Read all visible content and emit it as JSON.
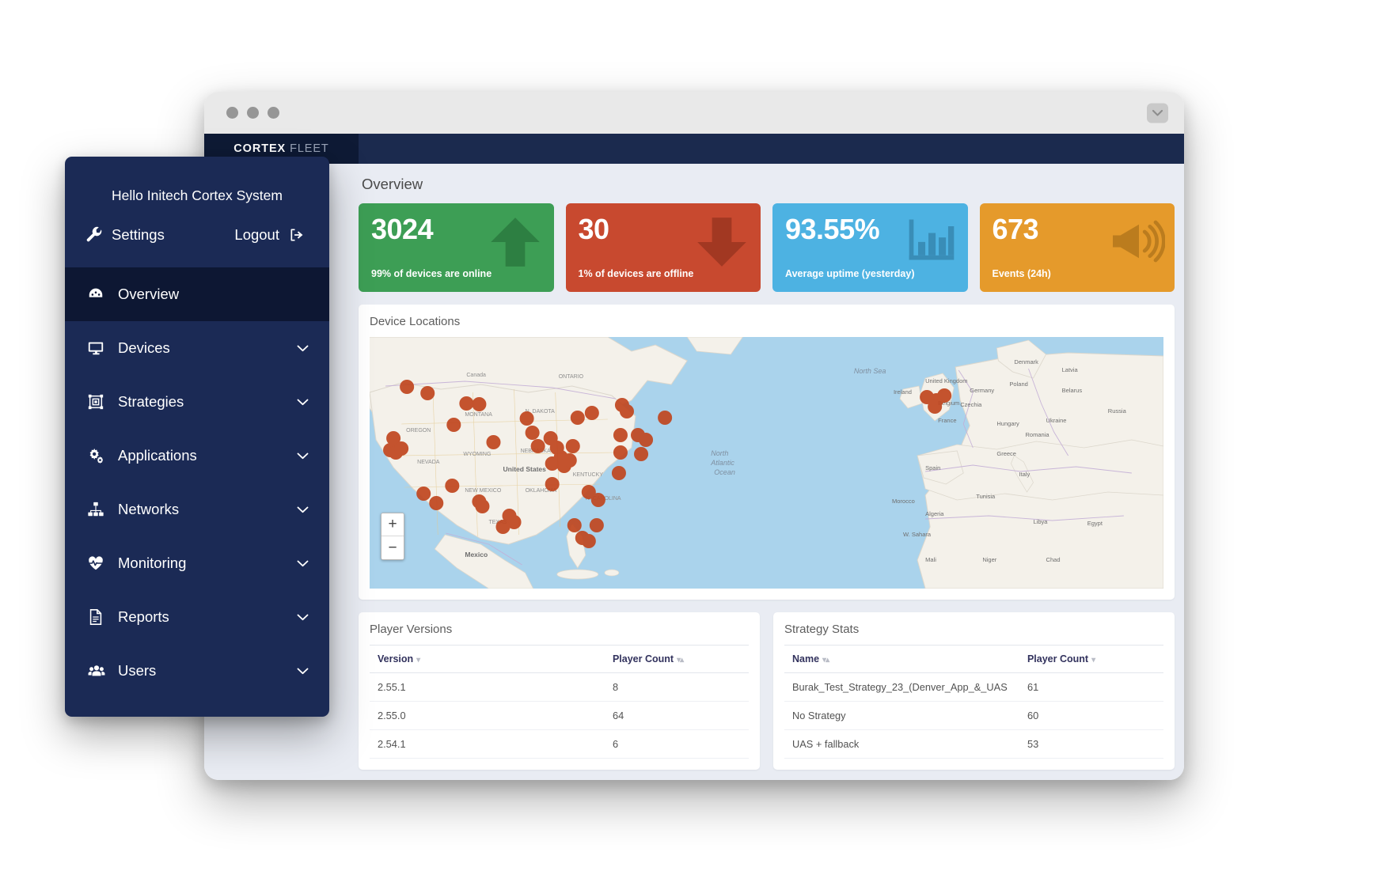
{
  "window": {
    "brand_primary": "CORTEX",
    "brand_secondary": "FLEET",
    "chevron_icon": "chevron-down-icon"
  },
  "sidebar": {
    "greeting": "Hello Initech Cortex System",
    "settings_label": "Settings",
    "logout_label": "Logout",
    "items": [
      {
        "label": "Overview",
        "icon": "gauge-icon",
        "active": true,
        "caret": false
      },
      {
        "label": "Devices",
        "icon": "monitor-icon",
        "active": false,
        "caret": true
      },
      {
        "label": "Strategies",
        "icon": "crop-icon",
        "active": false,
        "caret": true
      },
      {
        "label": "Applications",
        "icon": "gears-icon",
        "active": false,
        "caret": true
      },
      {
        "label": "Networks",
        "icon": "sitemap-icon",
        "active": false,
        "caret": true
      },
      {
        "label": "Monitoring",
        "icon": "heartbeat-icon",
        "active": false,
        "caret": true
      },
      {
        "label": "Reports",
        "icon": "document-icon",
        "active": false,
        "caret": true
      },
      {
        "label": "Users",
        "icon": "users-icon",
        "active": false,
        "caret": true
      }
    ]
  },
  "main": {
    "page_title": "Overview",
    "stats": [
      {
        "value": "3024",
        "caption": "99% of devices are online",
        "color": "#3d9e55",
        "icon": "arrow-up-icon"
      },
      {
        "value": "30",
        "caption": "1% of devices are offline",
        "color": "#c8492f",
        "icon": "arrow-down-icon"
      },
      {
        "value": "93.55%",
        "caption": "Average uptime (yesterday)",
        "color": "#4db2e2",
        "icon": "bar-chart-icon"
      },
      {
        "value": "673",
        "caption": "Events (24h)",
        "color": "#e59a2b",
        "icon": "megaphone-icon"
      }
    ],
    "map": {
      "title": "Device Locations",
      "zoom_in_label": "+",
      "zoom_out_label": "−",
      "marker_color": "#c0461f",
      "water_color": "#aad3ec",
      "land_color": "#f3f0ea"
    },
    "player_versions": {
      "title": "Player Versions",
      "columns": [
        "Version",
        "Player Count"
      ],
      "sort_glyphs": [
        "▾",
        "▾▴"
      ],
      "rows": [
        [
          "2.55.1",
          "8"
        ],
        [
          "2.55.0",
          "64"
        ],
        [
          "2.54.1",
          "6"
        ]
      ]
    },
    "strategy_stats": {
      "title": "Strategy Stats",
      "columns": [
        "Name",
        "Player Count"
      ],
      "sort_glyphs": [
        "▾▴",
        "▾"
      ],
      "rows": [
        [
          "Burak_Test_Strategy_23_(Denver_App_&_UAS",
          "61"
        ],
        [
          "No Strategy",
          "60"
        ],
        [
          "UAS + fallback",
          "53"
        ]
      ]
    }
  }
}
